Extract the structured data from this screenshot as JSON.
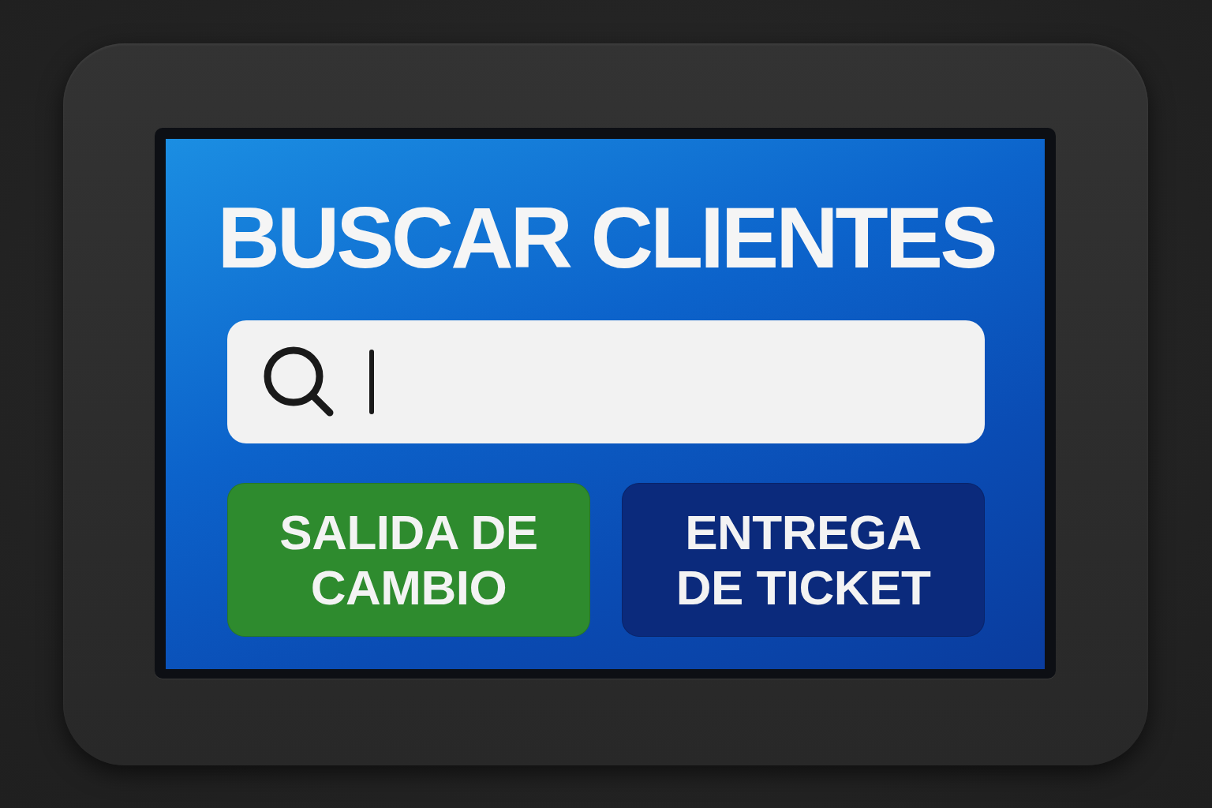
{
  "title": "BUSCAR CLIENTES",
  "search": {
    "focused": true
  },
  "buttons": [
    {
      "label": "SALIDA DE CAMBIO",
      "color": "#2e8b2e"
    },
    {
      "label": "ENTREGA DE TICKET",
      "color": "#0b2a7c"
    }
  ]
}
